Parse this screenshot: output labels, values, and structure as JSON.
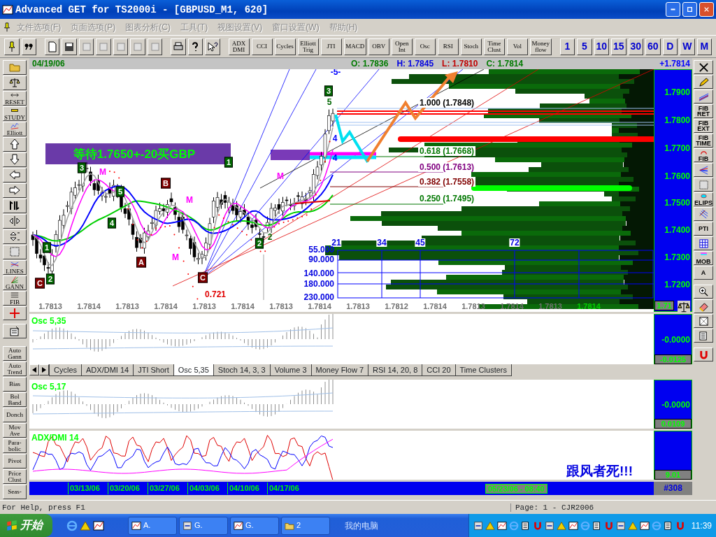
{
  "window": {
    "title": "Advanced GET for TS2000i - [GBPUSD_M1, 620]"
  },
  "menu": [
    "文件选项(F)",
    "页面选项(P)",
    "图表分析(C)",
    "工具(T)",
    "视图设置(V)",
    "窗口设置(W)",
    "帮助(H)"
  ],
  "study_buttons": [
    "ADX\nDMI",
    "CCI",
    "Cycles",
    "Elliott\nTrig",
    "JTI",
    "MACD",
    "OBV",
    "Open\nInt",
    "Osc",
    "RSI",
    "Stoch",
    "Time\nClust",
    "Vol",
    "Money\nflow"
  ],
  "timeframes": [
    "1",
    "5",
    "10",
    "15",
    "30",
    "60",
    "D",
    "W",
    "M"
  ],
  "left_tools": [
    "RESET",
    "STUDY",
    "Elliott",
    "LINES",
    "GANN",
    "FIB"
  ],
  "left_studies": [
    "Auto\nGann",
    "Auto\nTrend",
    "Bias",
    "Bol\nBand",
    "Donch",
    "Mov\nAve",
    "Para-\nbolic",
    "Pivot",
    "Price\nClust",
    "Seas-"
  ],
  "right_tools": [
    "FIB\nRET",
    "FIB\nEXT",
    "FIB\nTIME",
    "FIB",
    "ELIPS",
    "PTI",
    "MOB",
    "A"
  ],
  "header": {
    "date": "04/19/06",
    "open": "O: 1.7836",
    "high": "H: 1.7845",
    "low": "L: 1.7810",
    "close": "C: 1.7814",
    "change": "+1.7814"
  },
  "chart": {
    "note": "等待1.7650+-20买GBP",
    "fib_levels": [
      {
        "label": "1.000 (1.7848)",
        "color": "#000000"
      },
      {
        "label": "0.618 (1.7668)",
        "color": "#007700"
      },
      {
        "label": "0.500 (1.7613)",
        "color": "#800080"
      },
      {
        "label": "0.382 (1.7558)",
        "color": "#800000"
      },
      {
        "label": "0.250 (1.7495)",
        "color": "#007700"
      }
    ],
    "wave_labels": [
      {
        "text": "3",
        "kind": "box",
        "color": "#006600"
      },
      {
        "text": "M",
        "kind": "plain",
        "color": "#ff00ff"
      },
      {
        "text": "5",
        "kind": "box",
        "color": "#006600"
      },
      {
        "text": "4",
        "kind": "box",
        "color": "#006600"
      },
      {
        "text": "1",
        "kind": "box",
        "color": "#006600"
      },
      {
        "text": "2",
        "kind": "box",
        "color": "#006600"
      },
      {
        "text": "C",
        "kind": "box",
        "color": "#800000"
      },
      {
        "text": "B",
        "kind": "box",
        "color": "#800000"
      },
      {
        "text": "M",
        "kind": "plain",
        "color": "#ff00ff"
      },
      {
        "text": "A",
        "kind": "box",
        "color": "#800000"
      },
      {
        "text": "M",
        "kind": "plain",
        "color": "#ff00ff"
      },
      {
        "text": "C",
        "kind": "box",
        "color": "#800000"
      },
      {
        "text": "1",
        "kind": "box",
        "color": "#006600"
      },
      {
        "text": "2",
        "kind": "box",
        "color": "#006600"
      },
      {
        "text": "2",
        "kind": "plain",
        "color": "#006600"
      },
      {
        "text": "M",
        "kind": "plain",
        "color": "#ff00ff"
      },
      {
        "text": "3",
        "kind": "box",
        "color": "#006600"
      },
      {
        "text": "5",
        "kind": "plain",
        "color": "#006600"
      },
      {
        "text": "-5-",
        "kind": "plain",
        "color": "#0000ff"
      },
      {
        "text": "4",
        "kind": "plain",
        "color": "#0000ff"
      },
      {
        "text": "4",
        "kind": "plain",
        "color": "#0000ff"
      }
    ],
    "low_label": "0.721",
    "cycle_labels": [
      "21",
      "34",
      "45",
      "72"
    ],
    "time_labels": [
      "55.000",
      "90.000",
      "140.000",
      "180.000",
      "230.000"
    ],
    "x_labels": [
      "1.7813",
      "1.7814",
      "1.7813",
      "1.7814",
      "1.7813",
      "1.7814",
      "1.7813",
      "1.7814",
      "1.7813",
      "1.7812",
      "1.7814",
      "1.7813",
      "1.7814",
      "1.7813",
      "1.7814"
    ],
    "price_axis": [
      "1.7900",
      "1.7800",
      "1.7700",
      "1.7600",
      "1.7500",
      "1.7400",
      "1.7300",
      "1.7200"
    ],
    "axis_last": "1.71",
    "signature": "跟风者死!!!"
  },
  "panels": [
    {
      "title": "Osc 5,35",
      "zero": "-0.0000",
      "reading": "-0.0125"
    },
    {
      "title": "Osc 5,17",
      "zero": "-0.0000",
      "reading": "0.0109"
    },
    {
      "title": "ADX/DMI 14",
      "reading": "9.01"
    }
  ],
  "tabs": [
    {
      "label": "Cycles",
      "selected": false
    },
    {
      "label": "ADX/DMI 14",
      "selected": false
    },
    {
      "label": "JTI Short",
      "selected": false
    },
    {
      "label": "Osc 5,35",
      "selected": true
    },
    {
      "label": "Stoch 14, 3, 3",
      "selected": false
    },
    {
      "label": "Volume 3",
      "selected": false
    },
    {
      "label": "Money Flow 7",
      "selected": false
    },
    {
      "label": "RSI 14, 20, 8",
      "selected": false
    },
    {
      "label": "CCI 20",
      "selected": false
    },
    {
      "label": "Time Clusters",
      "selected": false
    }
  ],
  "date_bar": {
    "dates": [
      "03/13/06",
      "03/20/06",
      "03/27/06",
      "04/03/06",
      "04/10/06",
      "04/17/06"
    ],
    "cursor": "05/23/06 - 08:40",
    "bar_number": "#308"
  },
  "status_bar": {
    "help": "For Help, press F1",
    "page": "Page: 1 - CJR2006"
  },
  "taskbar": {
    "start": "开始",
    "tasks": [
      "A.",
      "G.",
      "G.",
      "2"
    ],
    "toolbar_label": "我的电脑",
    "clock": "11:39"
  }
}
